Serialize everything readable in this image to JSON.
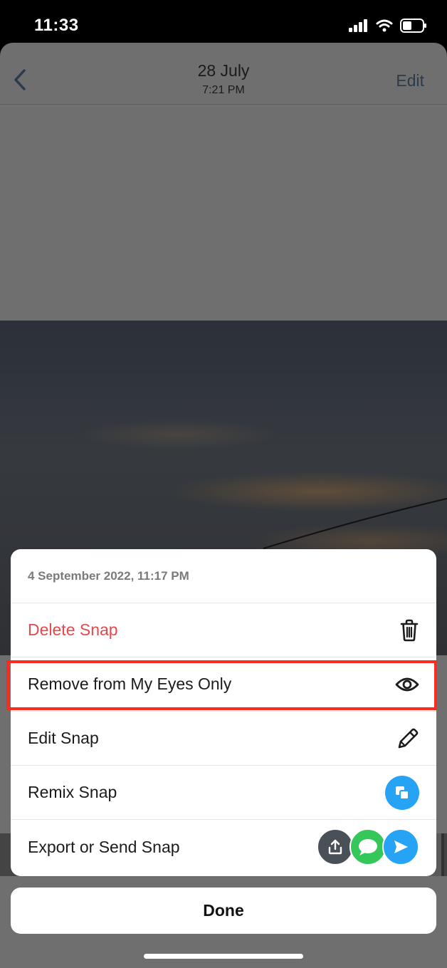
{
  "status_bar": {
    "time": "11:33"
  },
  "nav": {
    "date": "28 July",
    "time": "7:21 PM",
    "edit_label": "Edit"
  },
  "sheet": {
    "header": "4 September 2022, 11:17 PM",
    "items": [
      {
        "label": "Delete Snap",
        "icon": "trash-icon",
        "color": "#e5484d"
      },
      {
        "label": "Remove from My Eyes Only",
        "icon": "eye-icon"
      },
      {
        "label": "Edit Snap",
        "icon": "pencil-icon"
      },
      {
        "label": "Remix Snap",
        "icon": "remix-icon"
      },
      {
        "label": "Export or Send Snap",
        "icons": [
          "share-icon",
          "messages-icon",
          "send-icon"
        ]
      }
    ]
  },
  "done_label": "Done",
  "colors": {
    "accent_blue": "#27a3f5",
    "danger_red": "#e5484d",
    "highlight_red": "#ff2a1f"
  }
}
